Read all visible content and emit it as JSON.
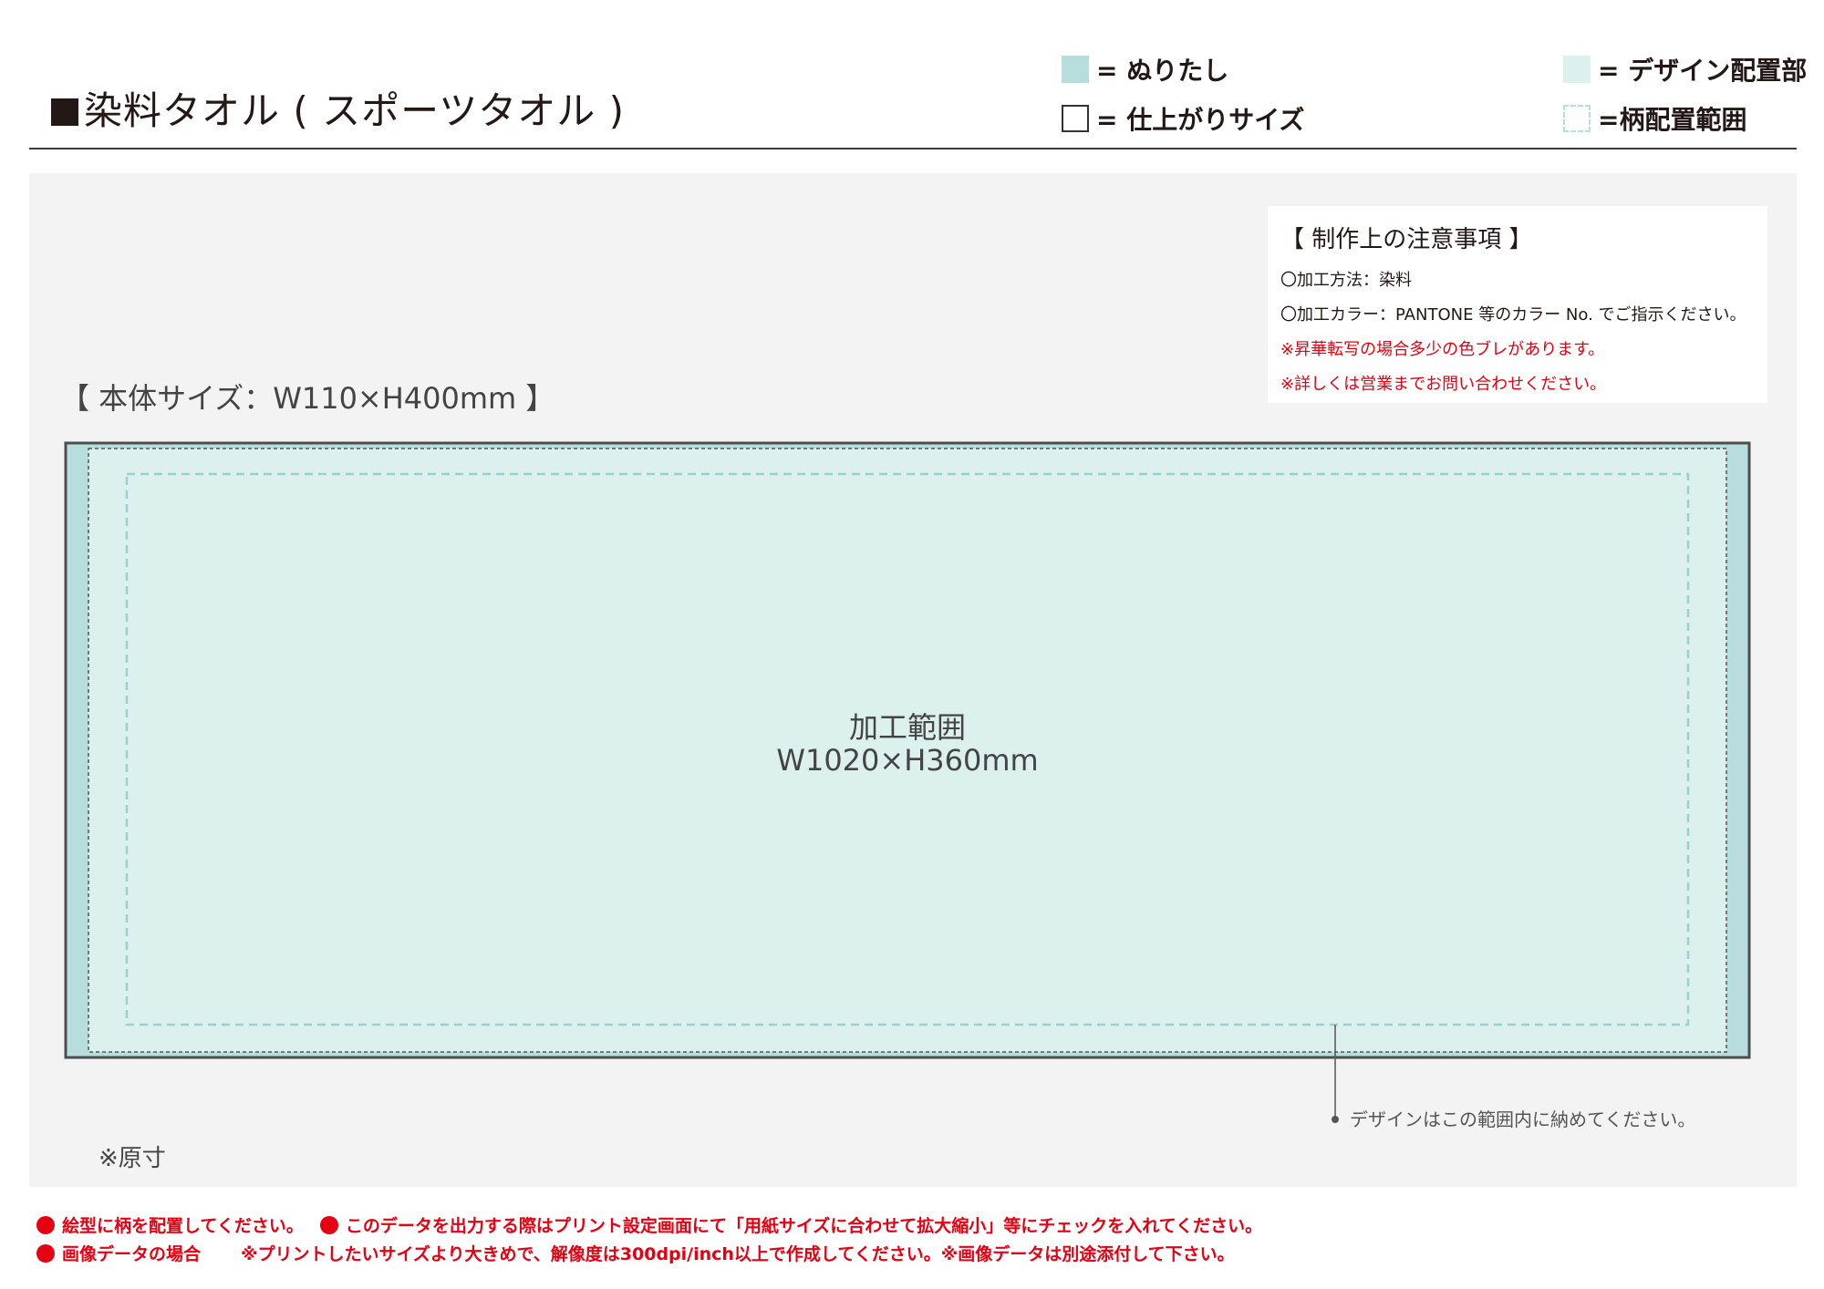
{
  "header": {
    "title": "染料タオル ( スポーツタオル )",
    "legend": {
      "bleed": "= ぬりたし",
      "finish_size": "= 仕上がりサイズ",
      "design_area": "= デザイン配置部",
      "pattern_area": "=柄配置範囲"
    },
    "colors": {
      "bleed": "#b7dedd",
      "design_area": "#dcf0ee"
    }
  },
  "notes": {
    "heading": "【 制作上の注意事項 】",
    "method": "〇加工方法：染料",
    "color": "〇加工カラー：PANTONE 等のカラー No. でご指示ください。",
    "warning_1": "※昇華転写の場合多少の色ブレがあります。",
    "warning_2": "※詳しくは営業までお問い合わせください。"
  },
  "body_size": "【 本体サイズ：W110×H400mm 】",
  "process_area": {
    "name": "加工範囲",
    "dims": "W1020×H360mm"
  },
  "annotation": "デザインはこの範囲内に納めてください。",
  "original_size": "※原寸",
  "footer": {
    "item_1": "絵型に柄を配置してください。",
    "item_2": "このデータを出力する際はプリント設定画面にて「用紙サイズに合わせて拡大縮小」等にチェックを入れてください。",
    "item_3": "画像データの場合",
    "item_3_detail": "※プリントしたいサイズより大きめで、解像度は300dpi/inch以上で作成してください。※画像データは別途添付して下さい。"
  }
}
